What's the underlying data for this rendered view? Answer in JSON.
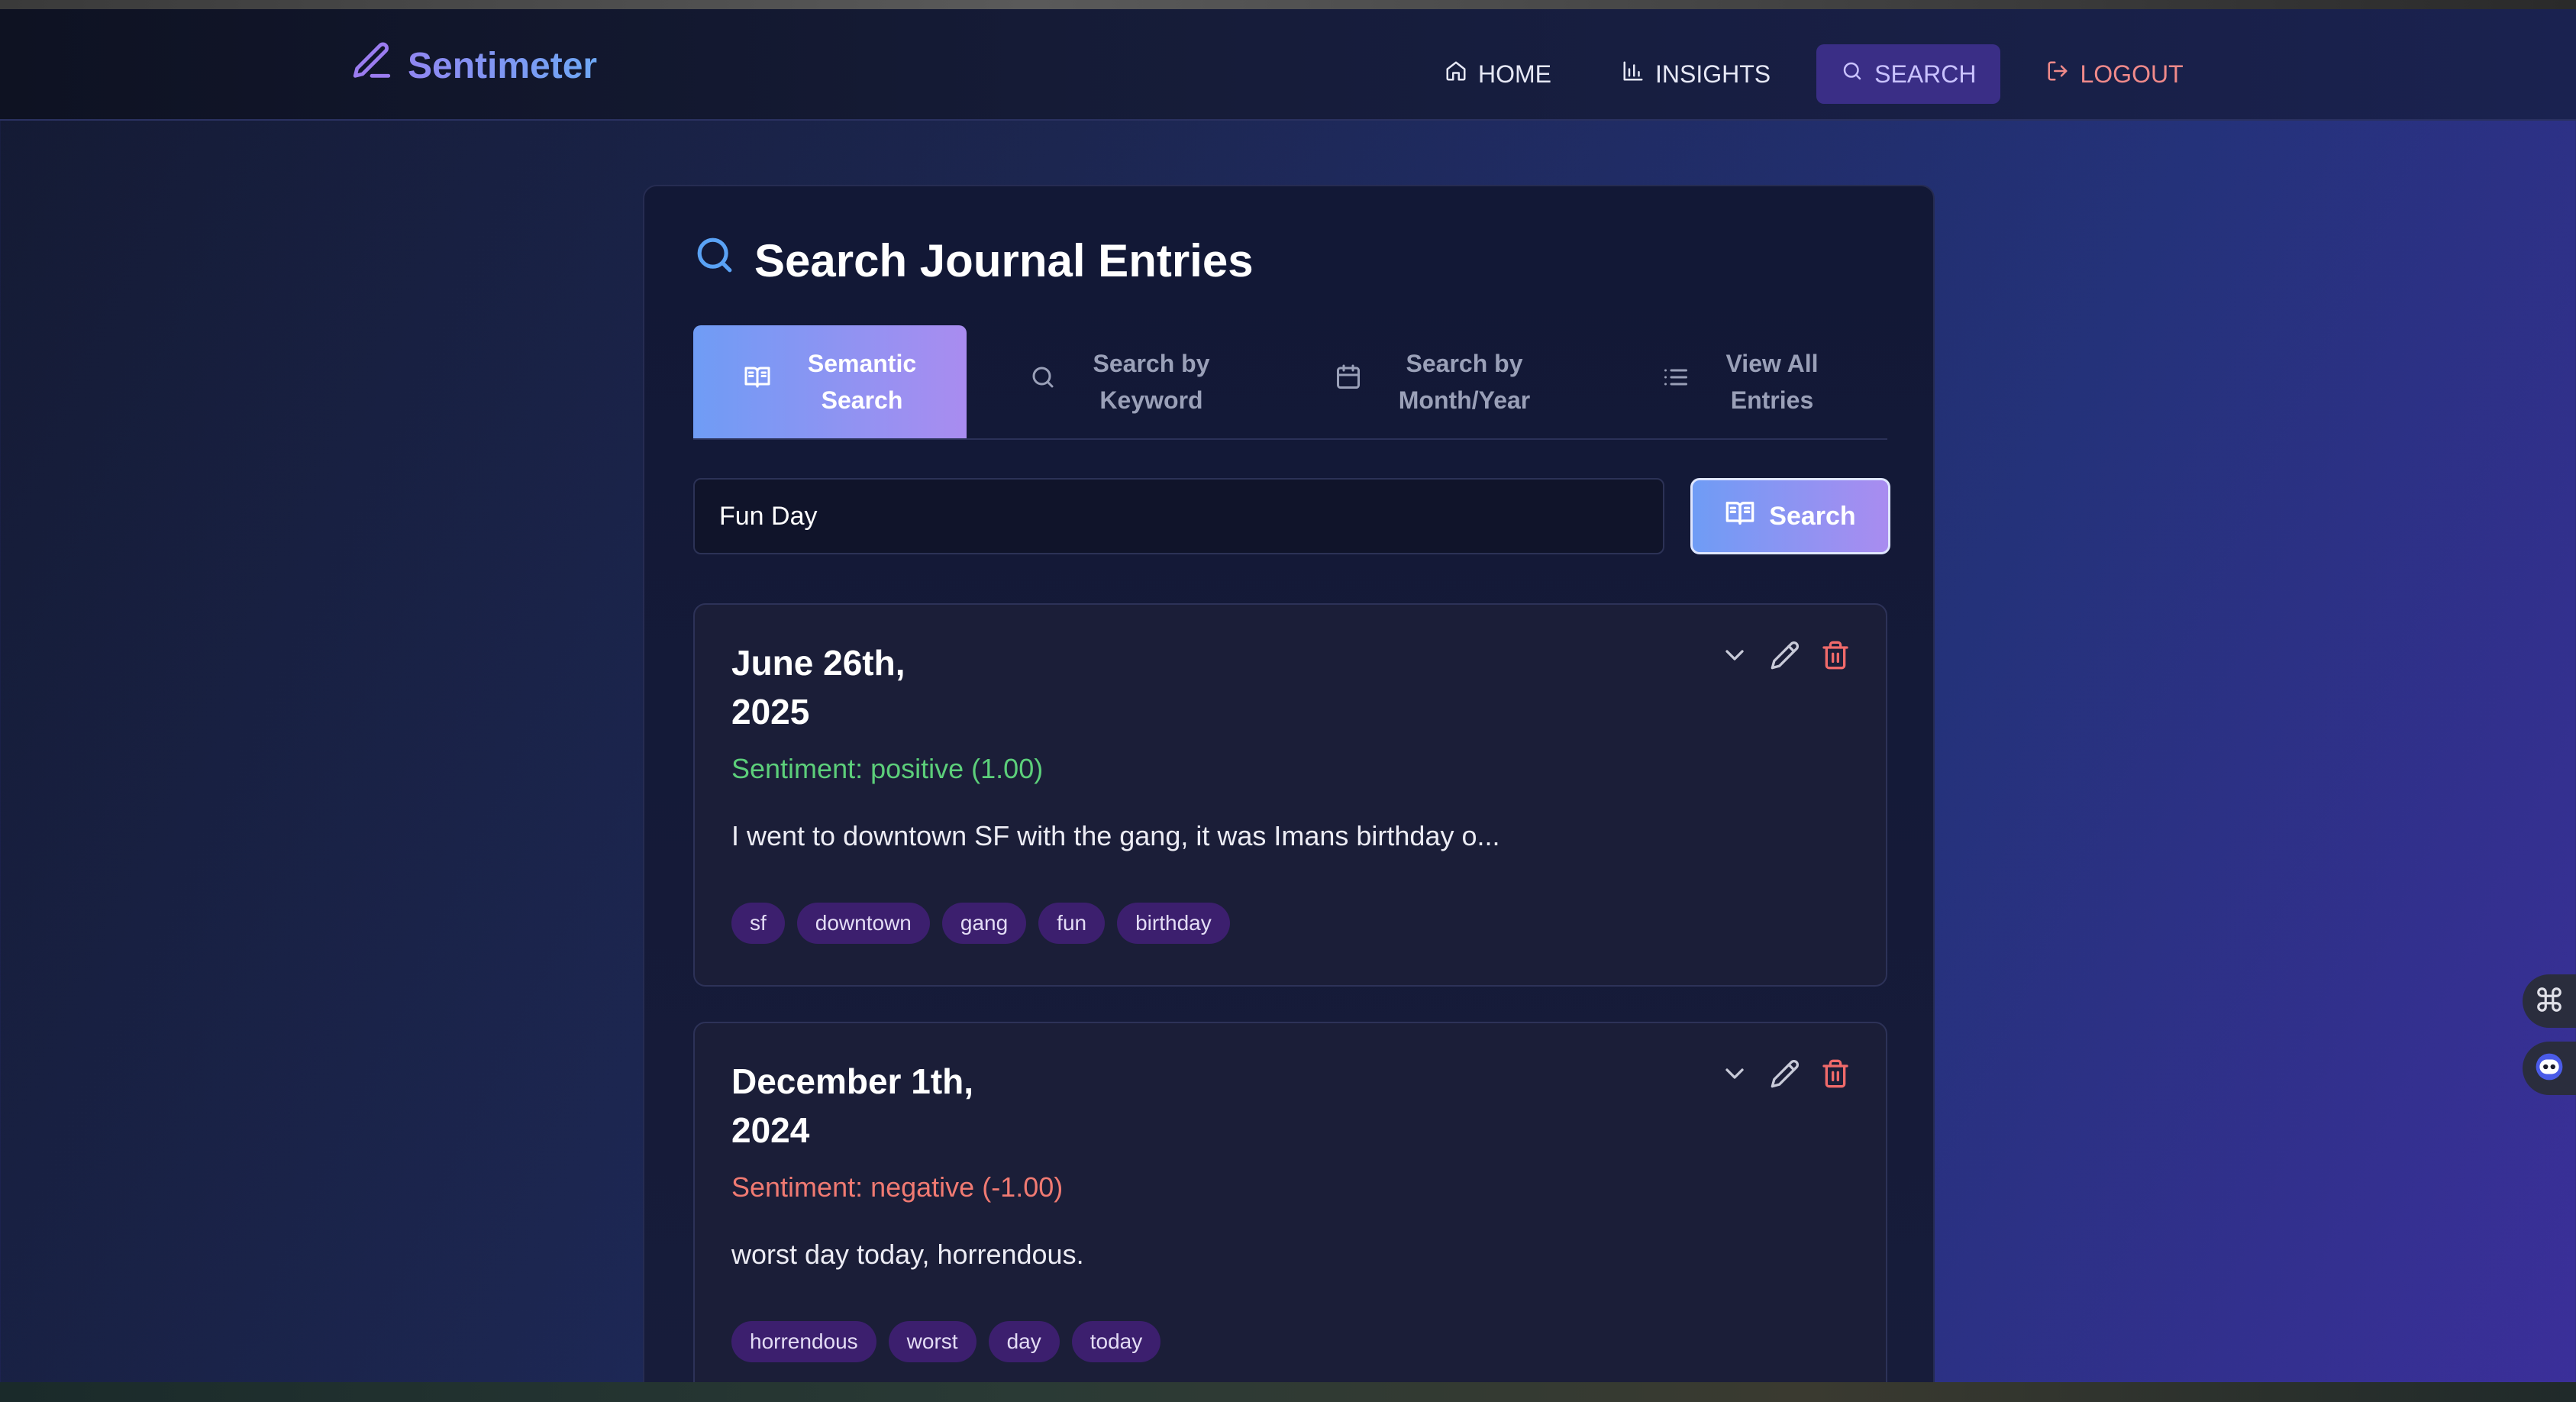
{
  "app": {
    "name": "Sentimeter"
  },
  "nav": {
    "home": "HOME",
    "insights": "INSIGHTS",
    "search": "SEARCH",
    "logout": "LOGOUT",
    "active": "search"
  },
  "page": {
    "title": "Search Journal Entries"
  },
  "tabs": [
    {
      "label": "Semantic\nSearch",
      "icon": "book-open-icon",
      "active": true
    },
    {
      "label": "Search by\nKeyword",
      "icon": "search-icon",
      "active": false
    },
    {
      "label": "Search by\nMonth/Year",
      "icon": "calendar-icon",
      "active": false
    },
    {
      "label": "View All\nEntries",
      "icon": "list-icon",
      "active": false
    }
  ],
  "search": {
    "value": "Fun Day",
    "button_label": "Search"
  },
  "entries": [
    {
      "date": "June 26th,\n2025",
      "sentiment": "Sentiment: positive (1.00)",
      "sentiment_type": "positive",
      "text": "I went to downtown SF with the gang, it was Imans birthday o...",
      "tags": [
        "sf",
        "downtown",
        "gang",
        "fun",
        "birthday"
      ]
    },
    {
      "date": "December 1th,\n2024",
      "sentiment": "Sentiment: negative (-1.00)",
      "sentiment_type": "negative",
      "text": "worst day today, horrendous.",
      "tags": [
        "horrendous",
        "worst",
        "day",
        "today"
      ]
    }
  ],
  "colors": {
    "accent_start": "#6f9cf5",
    "accent_end": "#a98cf0",
    "positive": "#5ccf7a",
    "negative": "#f07a72",
    "logout": "#f08a8a",
    "tag_bg": "#3c1f6e"
  }
}
